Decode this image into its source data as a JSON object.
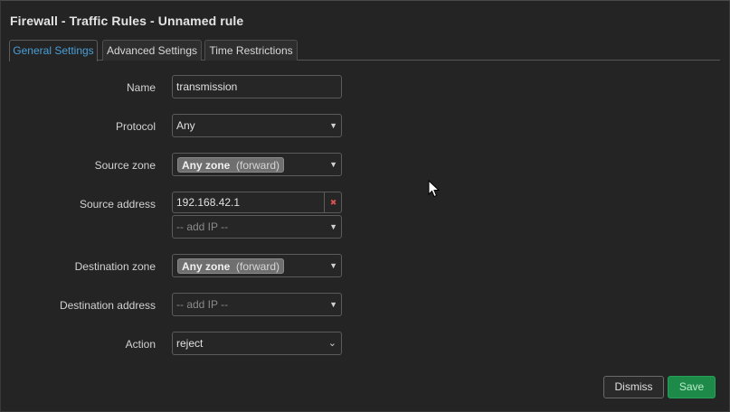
{
  "dialog": {
    "title": "Firewall - Traffic Rules - Unnamed rule"
  },
  "tabs": [
    {
      "label": "General Settings",
      "active": true
    },
    {
      "label": "Advanced Settings",
      "active": false
    },
    {
      "label": "Time Restrictions",
      "active": false
    }
  ],
  "form": {
    "name": {
      "label": "Name",
      "value": "transmission"
    },
    "protocol": {
      "label": "Protocol",
      "value": "Any"
    },
    "source_zone": {
      "label": "Source zone",
      "zone": "Any zone",
      "qualifier": "(forward)"
    },
    "source_address": {
      "label": "Source address",
      "value": "192.168.42.1",
      "remove_glyph": "✖",
      "add_placeholder": "-- add IP --"
    },
    "destination_zone": {
      "label": "Destination zone",
      "zone": "Any zone",
      "qualifier": "(forward)"
    },
    "destination_address": {
      "label": "Destination address",
      "add_placeholder": "-- add IP --"
    },
    "action": {
      "label": "Action",
      "value": "reject"
    }
  },
  "footer": {
    "dismiss_label": "Dismiss",
    "save_label": "Save"
  },
  "colors": {
    "background": "#242424",
    "active_tab": "#4a9fd8",
    "save": "#1e8a4a",
    "remove": "#d9534f"
  }
}
